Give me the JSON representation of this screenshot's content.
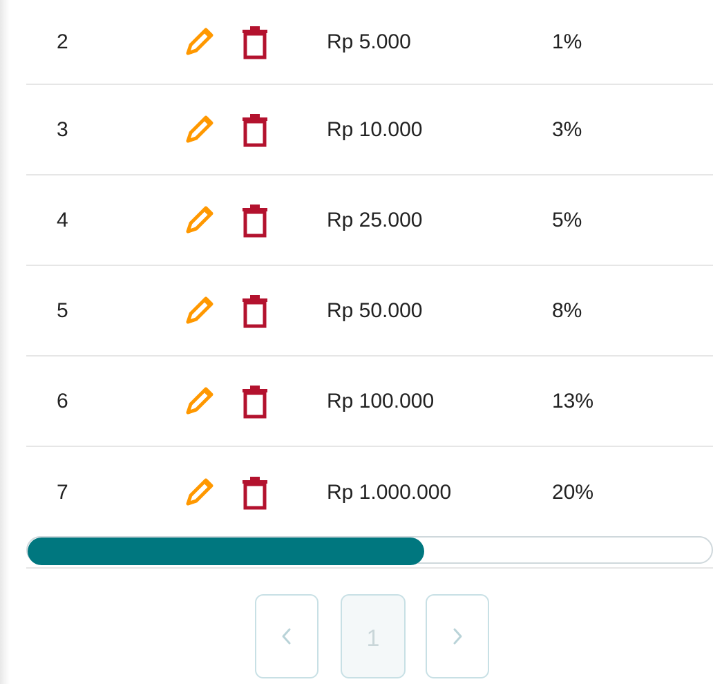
{
  "table": {
    "rows": [
      {
        "no": "2",
        "amount": "Rp 5.000",
        "percent": "1%"
      },
      {
        "no": "3",
        "amount": "Rp 10.000",
        "percent": "3%"
      },
      {
        "no": "4",
        "amount": "Rp 25.000",
        "percent": "5%"
      },
      {
        "no": "5",
        "amount": "Rp 50.000",
        "percent": "8%"
      },
      {
        "no": "6",
        "amount": "Rp 100.000",
        "percent": "13%"
      },
      {
        "no": "7",
        "amount": "Rp 1.000.000",
        "percent": "20%"
      }
    ]
  },
  "scrollbar": {
    "visible_fraction": 0.58
  },
  "pagination": {
    "prev_icon": "chevron-left-icon",
    "current_page": "1",
    "next_icon": "chevron-right-icon"
  },
  "icons": {
    "edit": "pencil-icon",
    "delete": "trash-icon"
  },
  "colors": {
    "edit": "#ff9800",
    "delete": "#b3122e",
    "scroll_thumb": "#00777f",
    "pagination_border": "#c8e0e5"
  }
}
